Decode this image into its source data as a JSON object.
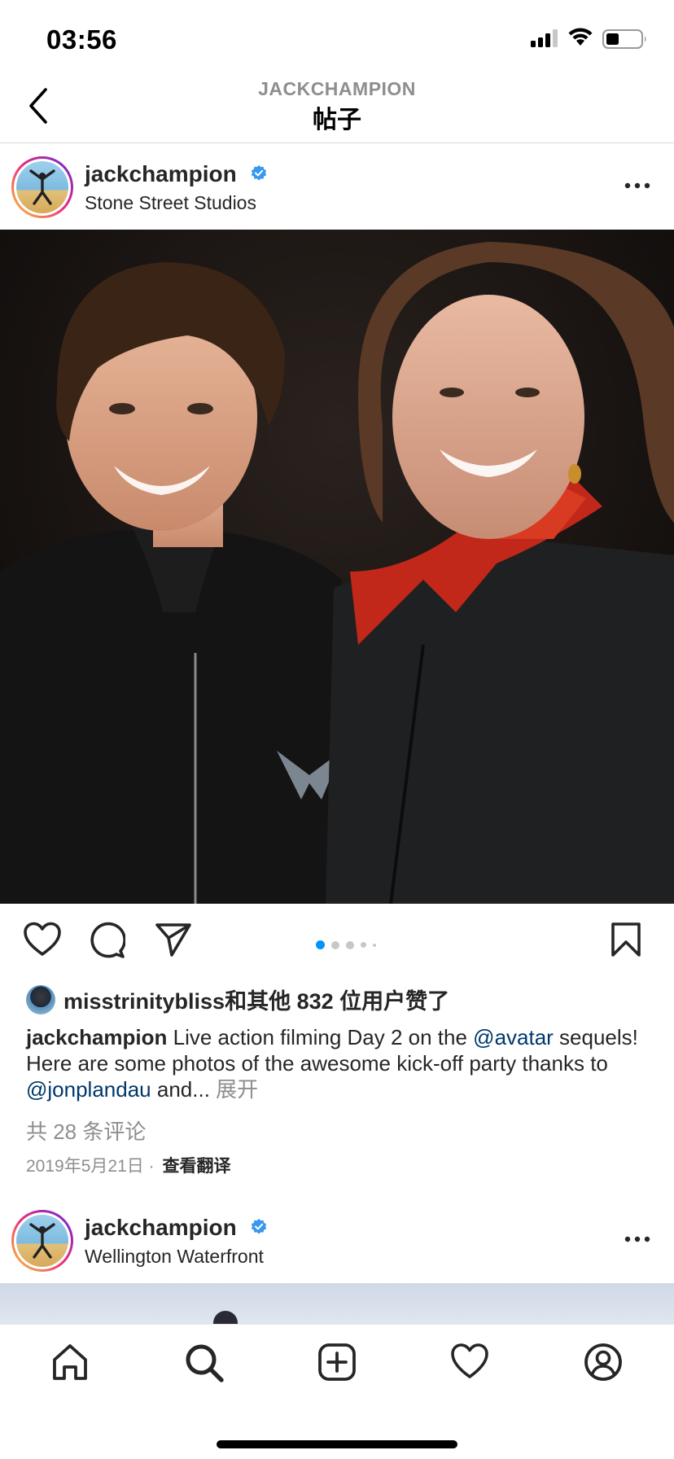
{
  "status_bar": {
    "time": "03:56"
  },
  "header": {
    "subtitle": "JACKCHAMPION",
    "title": "帖子"
  },
  "post1": {
    "username": "jackchampion",
    "location": "Stone Street Studios",
    "carousel_pages": 5,
    "carousel_active": 1,
    "liked_by": "misstrinitybliss和其他 832 位用户赞了",
    "caption": {
      "username": "jackchampion",
      "text1": " Live action filming Day 2 on the ",
      "mention1": "@avatar",
      "text2": " sequels! Here are some photos of the awesome kick-off party thanks to ",
      "mention2": "@jonplandau",
      "text3": " and... ",
      "more": "展开"
    },
    "comments": "共 28 条评论",
    "date": "2019年5月21日",
    "separator": "·",
    "translate": "查看翻译"
  },
  "post2": {
    "username": "jackchampion",
    "location": "Wellington Waterfront"
  },
  "icons": {
    "back": "chevron-left-icon",
    "verified": "verified-badge-icon",
    "more": "more-horizontal-icon",
    "like": "heart-icon",
    "comment": "comment-icon",
    "share": "send-icon",
    "save": "bookmark-icon",
    "tabs": [
      "home-icon",
      "search-icon",
      "add-post-icon",
      "activity-heart-icon",
      "profile-icon"
    ]
  },
  "colors": {
    "verified": "#3897f0",
    "mention": "#00376b",
    "dot_active": "#0095f6",
    "muted": "#8e8e8e"
  }
}
